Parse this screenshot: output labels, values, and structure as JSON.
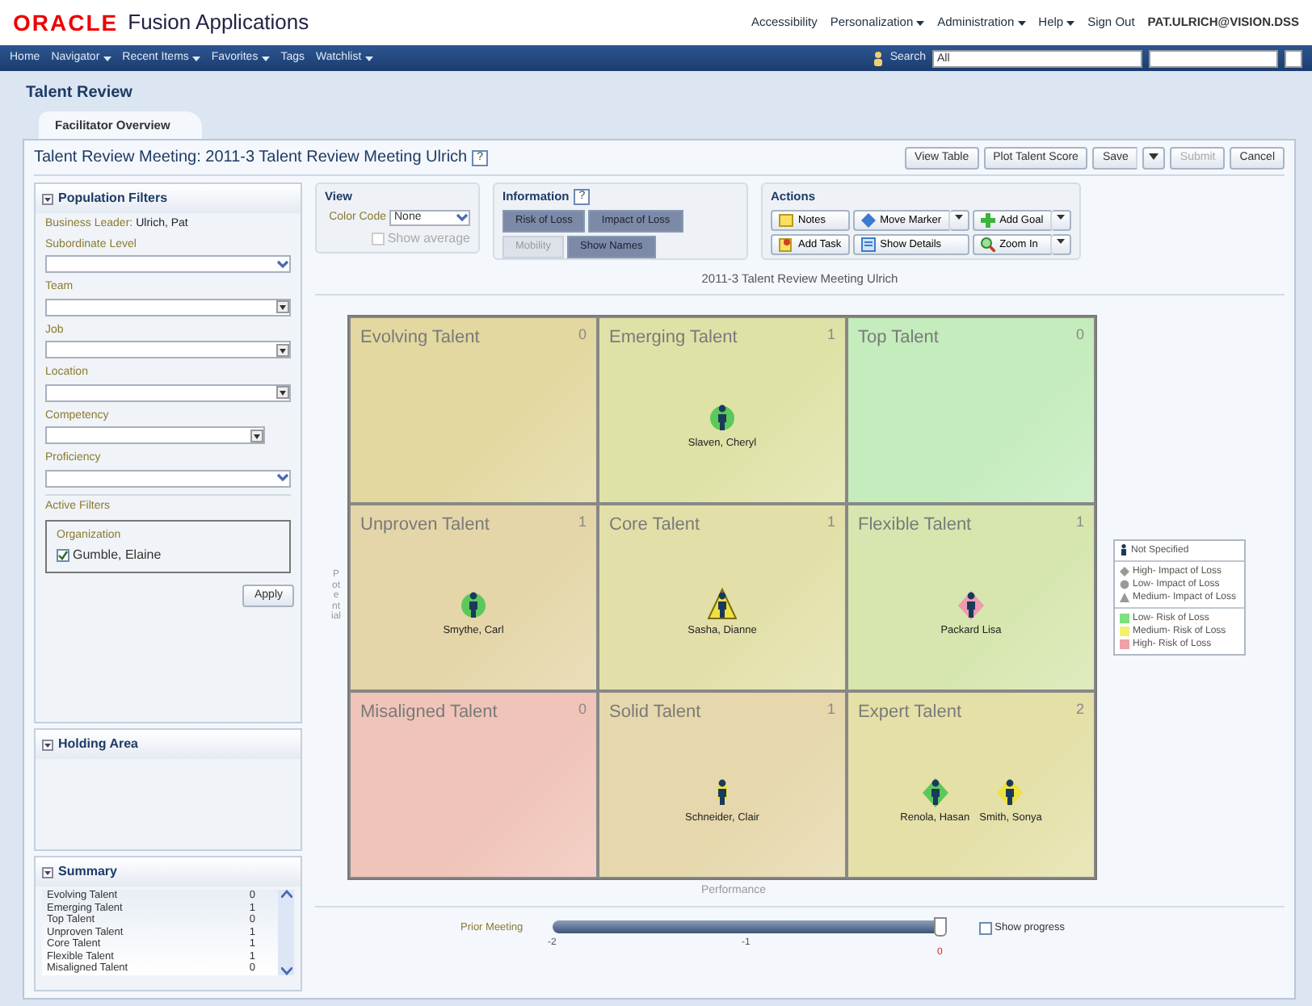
{
  "header": {
    "logo": "ORACLE",
    "product": "Fusion Applications",
    "links": [
      {
        "label": "Accessibility",
        "menu": false
      },
      {
        "label": "Personalization",
        "menu": true
      },
      {
        "label": "Administration",
        "menu": true
      },
      {
        "label": "Help",
        "menu": true
      },
      {
        "label": "Sign Out",
        "menu": false
      }
    ],
    "user": "PAT.ULRICH@VISION.DSS"
  },
  "nav": {
    "items": [
      {
        "label": "Home",
        "menu": false
      },
      {
        "label": "Navigator",
        "menu": true
      },
      {
        "label": "Recent Items",
        "menu": true
      },
      {
        "label": "Favorites",
        "menu": true
      },
      {
        "label": "Tags",
        "menu": false
      },
      {
        "label": "Watchlist",
        "menu": true
      }
    ],
    "search_label": "Search",
    "search_scope": "All"
  },
  "page_title": "Talent Review",
  "tabs": [
    {
      "label": "Facilitator Overview",
      "selected": true
    }
  ],
  "meeting_title": "Talent Review Meeting: 2011-3 Talent Review Meeting Ulrich",
  "meeting_help": "?",
  "toolbar_buttons": [
    {
      "label": "View Table",
      "menu": false,
      "disabled": false
    },
    {
      "label": "Plot Talent Score",
      "menu": false,
      "disabled": false
    },
    {
      "label": "Save",
      "menu": true,
      "disabled": false
    },
    {
      "label": "Submit",
      "menu": false,
      "disabled": true
    },
    {
      "label": "Cancel",
      "menu": false,
      "disabled": false
    }
  ],
  "filters": {
    "title": "Population Filters",
    "leader_label": "Business Leader:",
    "leader": "Ulrich, Pat",
    "fields": [
      {
        "label": "Subordinate Level",
        "kind": "choice"
      },
      {
        "label": "Team",
        "kind": "list"
      },
      {
        "label": "Job",
        "kind": "list"
      },
      {
        "label": "Location",
        "kind": "list"
      },
      {
        "label": "Competency",
        "kind": "list"
      },
      {
        "label": "Proficiency",
        "kind": "choice"
      }
    ],
    "active_label": "Active Filters",
    "group": "Organization",
    "items": [
      {
        "label": "Gumble, Elaine",
        "checked": true
      }
    ],
    "apply": "Apply"
  },
  "holding_area": {
    "title": "Holding Area"
  },
  "summary": {
    "title": "Summary",
    "rows": [
      {
        "label": "Evolving Talent",
        "count": "0"
      },
      {
        "label": "Emerging Talent",
        "count": "1"
      },
      {
        "label": "Top Talent",
        "count": "0"
      },
      {
        "label": "Unproven Talent",
        "count": "1"
      },
      {
        "label": "Core Talent",
        "count": "1"
      },
      {
        "label": "Flexible Talent",
        "count": "1"
      },
      {
        "label": "Misaligned Talent",
        "count": "0"
      }
    ]
  },
  "view": {
    "title": "View",
    "color_code_label": "Color Code",
    "color_code": "None",
    "show_average": {
      "label": "Show average",
      "checked": false,
      "disabled": true
    }
  },
  "information": {
    "title": "Information",
    "help": "?",
    "toggles": [
      {
        "label": "Risk of Loss",
        "selected": true
      },
      {
        "label": "Impact of Loss",
        "selected": true
      },
      {
        "label": "Mobility",
        "selected": false
      },
      {
        "label": "Show Names",
        "selected": true
      }
    ]
  },
  "actions": {
    "title": "Actions",
    "buttons": [
      {
        "label": "Notes",
        "kind": "note",
        "menu": false
      },
      {
        "label": "Move Marker",
        "kind": "move",
        "menu": true
      },
      {
        "label": "Add Goal",
        "kind": "add",
        "menu": true
      },
      {
        "label": "Add Task",
        "kind": "task",
        "menu": false
      },
      {
        "label": "Show Details",
        "kind": "details",
        "menu": false
      },
      {
        "label": "Zoom In",
        "kind": "zoom",
        "menu": true
      }
    ]
  },
  "grid": {
    "title": "2011-3 Talent Review Meeting Ulrich",
    "y_label": "Potential",
    "x_label": "Performance",
    "cells": [
      {
        "title": "Evolving Talent",
        "count": "0",
        "color": "#e2d8a0"
      },
      {
        "title": "Emerging Talent",
        "count": "1",
        "color": "#dfe2a6",
        "people": [
          {
            "name": "Slaven, Cheryl",
            "kind": "circle",
            "color": "#5cc85c"
          }
        ]
      },
      {
        "title": "Top Talent",
        "count": "0",
        "color": "#c4ecbc"
      },
      {
        "title": "Unproven Talent",
        "count": "1",
        "color": "#e4d6a8",
        "people": [
          {
            "name": "Smythe, Carl",
            "kind": "circle",
            "color": "#5cc85c"
          }
        ]
      },
      {
        "title": "Core Talent",
        "count": "1",
        "color": "#e2e0a8",
        "people": [
          {
            "name": "Sasha, Dianne",
            "kind": "triangle",
            "color": "#f0e040"
          }
        ]
      },
      {
        "title": "Flexible Talent",
        "count": "1",
        "color": "#d6e6ae",
        "people": [
          {
            "name": "Packard Lisa",
            "kind": "diamond",
            "color": "#f09ab0"
          }
        ]
      },
      {
        "title": "Misaligned Talent",
        "count": "0",
        "color": "#f0c4b8"
      },
      {
        "title": "Solid Talent",
        "count": "1",
        "color": "#e6d8ac",
        "people": [
          {
            "name": "Schneider, Clair",
            "kind": "none",
            "color": "#f0e040"
          }
        ]
      },
      {
        "title": "Expert Talent",
        "count": "2",
        "color": "#e4e0a8",
        "people": [
          {
            "name": "Renola, Hasan",
            "kind": "diamond",
            "color": "#5cc85c"
          },
          {
            "name": "Smith, Sonya",
            "kind": "diamond",
            "color": "#f0e040"
          }
        ]
      }
    ]
  },
  "legend": {
    "sections": [
      [
        {
          "label": "Not Specified",
          "kind": "figure"
        }
      ],
      [
        {
          "label": "High- Impact of Loss",
          "kind": "diamond"
        },
        {
          "label": "Low- Impact of Loss",
          "kind": "circle"
        },
        {
          "label": "Medium- Impact of Loss",
          "kind": "triangle"
        }
      ],
      [
        {
          "label": "Low- Risk of Loss",
          "kind": "swatch",
          "color": "#7ee07e"
        },
        {
          "label": "Medium- Risk of Loss",
          "kind": "swatch",
          "color": "#f4f070"
        },
        {
          "label": "High- Risk of Loss",
          "kind": "swatch",
          "color": "#f0a0a8"
        }
      ]
    ]
  },
  "slider": {
    "label": "Prior Meeting",
    "level": 1,
    "ticks": [
      {
        "label": "-2",
        "current": false
      },
      {
        "label": "-1",
        "current": false
      },
      {
        "label": "0",
        "current": true
      }
    ],
    "show_progress": {
      "label": "Show progress",
      "checked": false
    }
  }
}
